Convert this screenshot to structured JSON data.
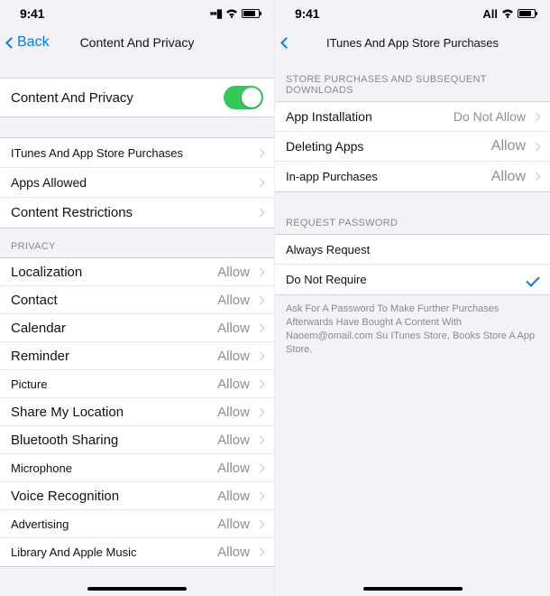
{
  "status": {
    "time": "9:41",
    "signal": "▪▪▮",
    "alt_signal_prefix": "All"
  },
  "left": {
    "back": "Back",
    "title": "Content And Privacy",
    "main_toggle": {
      "label": "Content And Privacy",
      "on": true
    },
    "nav_items": [
      {
        "label": "ITunes And App Store Purchases"
      },
      {
        "label": "Apps Allowed"
      },
      {
        "label": "Content Restrictions"
      }
    ],
    "privacy_header": "Privacy",
    "privacy_items": [
      {
        "label": "Localization",
        "value": "Allow"
      },
      {
        "label": "Contact",
        "value": "Allow"
      },
      {
        "label": "Calendar",
        "value": "Allow"
      },
      {
        "label": "Reminder",
        "value": "Allow"
      },
      {
        "label": "Picture",
        "value": "Allow",
        "small": true
      },
      {
        "label": "Share My Location",
        "value": "Allow"
      },
      {
        "label": "Bluetooth Sharing",
        "value": "Allow"
      },
      {
        "label": "Microphone",
        "value": "Allow",
        "small": true
      },
      {
        "label": "Voice Recognition",
        "value": "Allow"
      },
      {
        "label": "Advertising",
        "value": "Allow",
        "small": true
      },
      {
        "label": "Library And Apple Music",
        "value": "Allow",
        "small": true
      }
    ]
  },
  "right": {
    "title": "ITunes And App Store Purchases",
    "store_header": "Store Purchases And Subsequent Downloads",
    "store_items": [
      {
        "label": "App Installation",
        "value": "Do Not Allow"
      },
      {
        "label": "Deleting Apps",
        "value": "Allow"
      },
      {
        "label": "In-app Purchases",
        "value": "Allow"
      }
    ],
    "request_header": "Request Password",
    "request_items": [
      {
        "label": "Always Request",
        "selected": false
      },
      {
        "label": "Do Not Require",
        "selected": true
      }
    ],
    "footer": "Ask For A Password To Make Further Purchases Afterwards Have Bought A Content With Naoem@omail.com Su ITunes Store, Books Store A App Store."
  }
}
